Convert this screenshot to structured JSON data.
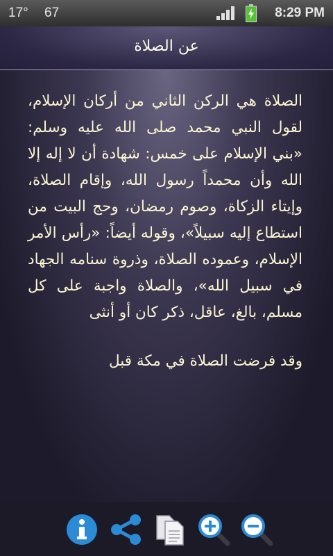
{
  "status_bar": {
    "temperature": "17°",
    "notification": "67",
    "time": "8:29 PM"
  },
  "header": {
    "title": "عن الصلاة"
  },
  "article": {
    "paragraphs": [
      "الصلاة هي الركن الثاني من أركان الإسلام، لقول النبي محمد صلى الله عليه وسلم: «بني الإسلام على خمس: شهادة أن لا إله إلا الله وأن محمداً رسول الله، وإقام الصلاة، وإيتاء الزكاة، وصوم رمضان، وحج البيت من استطاع إليه سبيلاً»، وقوله أيضاً: «رأس الأمر الإسلام، وعموده الصلاة، وذروة سنامه الجهاد في سبيل الله»، والصلاة واجبة على كل مسلم، بالغ، عاقل، ذكر كان أو أنثى",
      "وقد فرضت الصلاة في مكة قبل"
    ]
  },
  "toolbar": {
    "icons": [
      "info-icon",
      "share-icon",
      "copy-icon",
      "zoom-in-icon",
      "zoom-out-icon"
    ]
  },
  "colors": {
    "text": "#fbf7d2",
    "icon_blue": "#2b8bd6"
  }
}
